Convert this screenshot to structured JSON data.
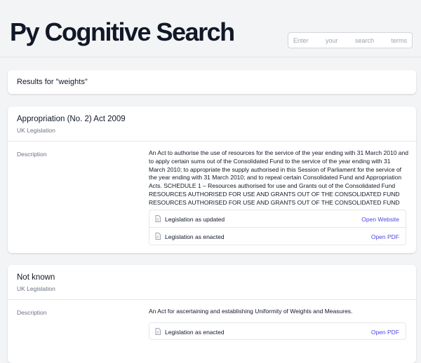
{
  "app": {
    "title": "Py Cognitive Search"
  },
  "search": {
    "placeholder": "Enter your search terms..."
  },
  "results_header": "Results for \"weights\"",
  "results": [
    {
      "title": "Appropriation (No. 2) Act 2009",
      "source": "UK Legislation",
      "description_label": "Description",
      "description": "An Act to authorise the use of resources for the service of the year ending with 31 March 2010 and to apply certain sums out of the Consolidated Fund to the service of the year ending with 31 March 2010; to appropriate the supply authorised in this Session of Parliament for the service of the year ending with 31 March 2010; and to repeal certain Consolidated Fund and Appropriation Acts. SCHEDULE 1 – Resources authorised for use and Grants out of the Consolidated Fund RESOURCES AUTHORISED FOR USE AND GRANTS OUT OF THE CONSOLIDATED FUND RESOURCES AUTHORISED FOR USE AND GRANTS OUT OF THE CONSOLIDATED FUND",
      "links": [
        {
          "name": "Legislation as updated",
          "action": "Open Website",
          "icon": "document-icon"
        },
        {
          "name": "Legislation as enacted",
          "action": "Open PDF",
          "icon": "document-icon"
        }
      ]
    },
    {
      "title": "Not known",
      "source": "UK Legislation",
      "description_label": "Description",
      "description": "An Act for ascertaining and establishing Uniformity of Weights and Measures.",
      "links": [
        {
          "name": "Legislation as enacted",
          "action": "Open PDF",
          "icon": "document-icon"
        }
      ]
    }
  ],
  "colors": {
    "background": "#f3f4f6",
    "card": "#ffffff",
    "link": "#4f46e5",
    "muted_text": "#6b7280",
    "icon": "#9ca3af"
  }
}
